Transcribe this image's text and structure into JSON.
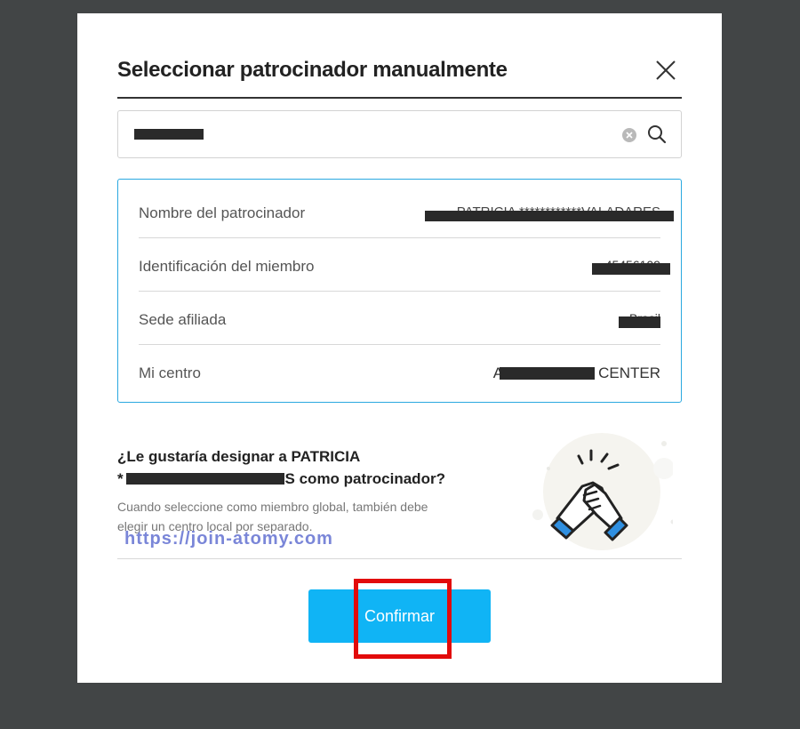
{
  "dialog": {
    "title": "Seleccionar patrocinador manualmente",
    "close_icon": "close-icon"
  },
  "search": {
    "value": "45456109",
    "clear_icon": "clear-circle-icon",
    "search_icon": "search-icon"
  },
  "sponsor_info": {
    "rows": [
      {
        "label": "Nombre del patrocinador",
        "value": "PATRICIA ************VALADARES"
      },
      {
        "label": "Identificación del miembro",
        "value": "45456109"
      },
      {
        "label": "Sede afiliada",
        "value": "Brasil"
      },
      {
        "label": "Mi centro",
        "value": "A                    L CENTER"
      }
    ]
  },
  "question": {
    "line1": "¿Le gustaría designar a PATRICIA",
    "line2": "VALADARES como patrocinador?",
    "note_line1": "Cuando seleccione como miembro global, también debe",
    "note_line2": "elegir un centro local por separado."
  },
  "watermark": "https://join-atomy.com",
  "confirm_label": "Confirmar",
  "colors": {
    "accent": "#10b4f5",
    "info_border": "#2aa8e0",
    "highlight": "#e20b0b",
    "backdrop": "#424546"
  }
}
